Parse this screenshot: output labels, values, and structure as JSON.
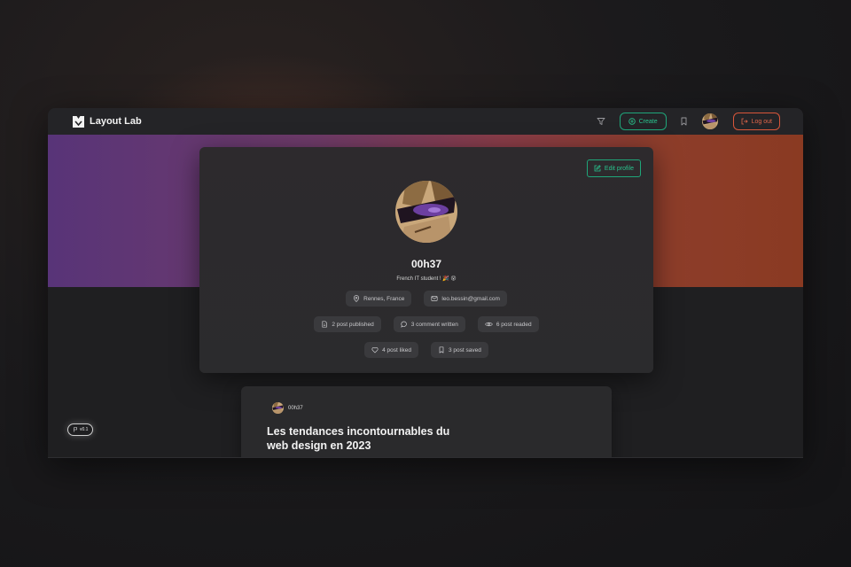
{
  "app": {
    "name": "Layout Lab",
    "version": "v0.1"
  },
  "navbar": {
    "create_label": "Create",
    "logout_label": "Log out"
  },
  "colors": {
    "accent_green": "#29c38e",
    "accent_red": "#e2664a",
    "banner_start": "#583478",
    "banner_end": "#8a3a22"
  },
  "profile": {
    "edit_label": "Edit profile",
    "username": "00h37",
    "bio": "French IT student ! 🎉 😵",
    "location": "Rennes, France",
    "email": "leo.bessin@gmail.com",
    "stats": {
      "published": "2 post published",
      "comments": "3 comment written",
      "readed": "6 post readed",
      "liked": "4 post liked",
      "saved": "3 post saved"
    }
  },
  "post": {
    "author": "00h37",
    "title": "Les tendances incontournables du web design en 2023"
  },
  "icons": [
    "logo-icon",
    "filter-icon",
    "plus-circle-icon",
    "bookmark-icon",
    "logout-icon",
    "edit-icon",
    "location-icon",
    "mail-icon",
    "file-icon",
    "comment-icon",
    "eye-icon",
    "heart-icon",
    "bookmark-icon",
    "version-icon"
  ]
}
